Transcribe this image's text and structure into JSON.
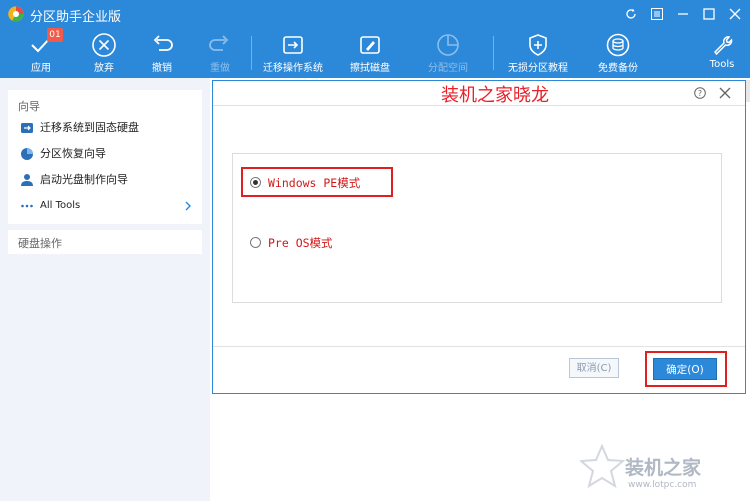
{
  "window": {
    "title": "分区助手企业版"
  },
  "toolbar": {
    "apply": "应用",
    "apply_badge": "01",
    "discard": "放弃",
    "undo": "撤销",
    "redo": "重做",
    "migrate_os": "迁移操作系统",
    "wipe_disk": "擦拭磁盘",
    "allocate_space": "分配空间",
    "lossless_tutorial": "无损分区教程",
    "free_backup": "免费备份",
    "tools": "Tools"
  },
  "sidebar": {
    "wizard_title": "向导",
    "items": [
      {
        "label": "迁移系统到固态硬盘"
      },
      {
        "label": "分区恢复向导"
      },
      {
        "label": "启动光盘制作向导"
      },
      {
        "label": "All Tools"
      }
    ],
    "disk_ops_title": "硬盘操作"
  },
  "dialog": {
    "watermark": "装机之家晓龙",
    "options": [
      {
        "label": "Windows PE模式",
        "selected": true
      },
      {
        "label": "Pre OS模式",
        "selected": false
      }
    ],
    "cancel_button": "取消(C)",
    "ok_button": "确定(O)"
  },
  "watermark": {
    "site": "装机之家",
    "url": "www.lotpc.com"
  },
  "colors": {
    "accent": "#2c88d9",
    "highlight": "#e02020"
  }
}
